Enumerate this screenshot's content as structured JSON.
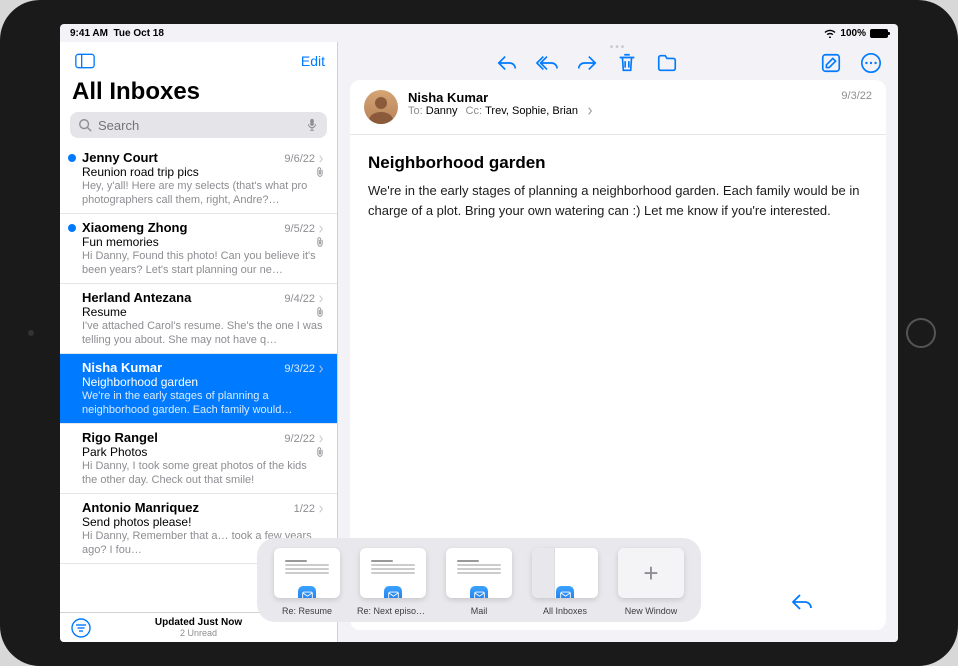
{
  "statusBar": {
    "time": "9:41 AM",
    "date": "Tue Oct 18",
    "battery": "100%"
  },
  "sidebar": {
    "editLabel": "Edit",
    "title": "All Inboxes",
    "searchPlaceholder": "Search",
    "footerLine1": "Updated Just Now",
    "footerLine2": "2 Unread"
  },
  "messages": [
    {
      "sender": "Jenny Court",
      "date": "9/6/22",
      "subject": "Reunion road trip pics",
      "preview": "Hey, y'all! Here are my selects (that's what pro photographers call them, right, Andre?…",
      "unread": true,
      "attachment": true
    },
    {
      "sender": "Xiaomeng Zhong",
      "date": "9/5/22",
      "subject": "Fun memories",
      "preview": "Hi Danny, Found this photo! Can you believe it's been years? Let's start planning our ne…",
      "unread": true,
      "attachment": true
    },
    {
      "sender": "Herland Antezana",
      "date": "9/4/22",
      "subject": "Resume",
      "preview": "I've attached Carol's resume. She's the one I was telling you about. She may not have q…",
      "unread": false,
      "attachment": true
    },
    {
      "sender": "Nisha Kumar",
      "date": "9/3/22",
      "subject": "Neighborhood garden",
      "preview": "We're in the early stages of planning a neighborhood garden. Each family would…",
      "unread": false,
      "attachment": false,
      "selected": true
    },
    {
      "sender": "Rigo Rangel",
      "date": "9/2/22",
      "subject": "Park Photos",
      "preview": "Hi Danny, I took some great photos of the kids the other day. Check out that smile!",
      "unread": false,
      "attachment": true
    },
    {
      "sender": "Antonio Manriquez",
      "date": "1/22",
      "subject": "Send photos please!",
      "preview": "Hi Danny, Remember that a…  took a few years ago? I fou…",
      "unread": false,
      "attachment": false
    }
  ],
  "detail": {
    "from": "Nisha Kumar",
    "toLabel": "To:",
    "toValue": "Danny",
    "ccLabel": "Cc:",
    "ccValue": "Trev, Sophie, Brian",
    "date": "9/3/22",
    "subject": "Neighborhood garden",
    "body": "We're in the early stages of planning a neighborhood garden. Each family would be in charge of a plot. Bring your own watering can :) Let me know if you're interested."
  },
  "shelf": [
    {
      "label": "Re: Resume",
      "badge": true
    },
    {
      "label": "Re: Next episode's g…",
      "badge": true
    },
    {
      "label": "Mail",
      "badge": true
    },
    {
      "label": "All Inboxes",
      "badge": true,
      "split": true
    },
    {
      "label": "New Window",
      "badge": false,
      "new": true
    }
  ]
}
